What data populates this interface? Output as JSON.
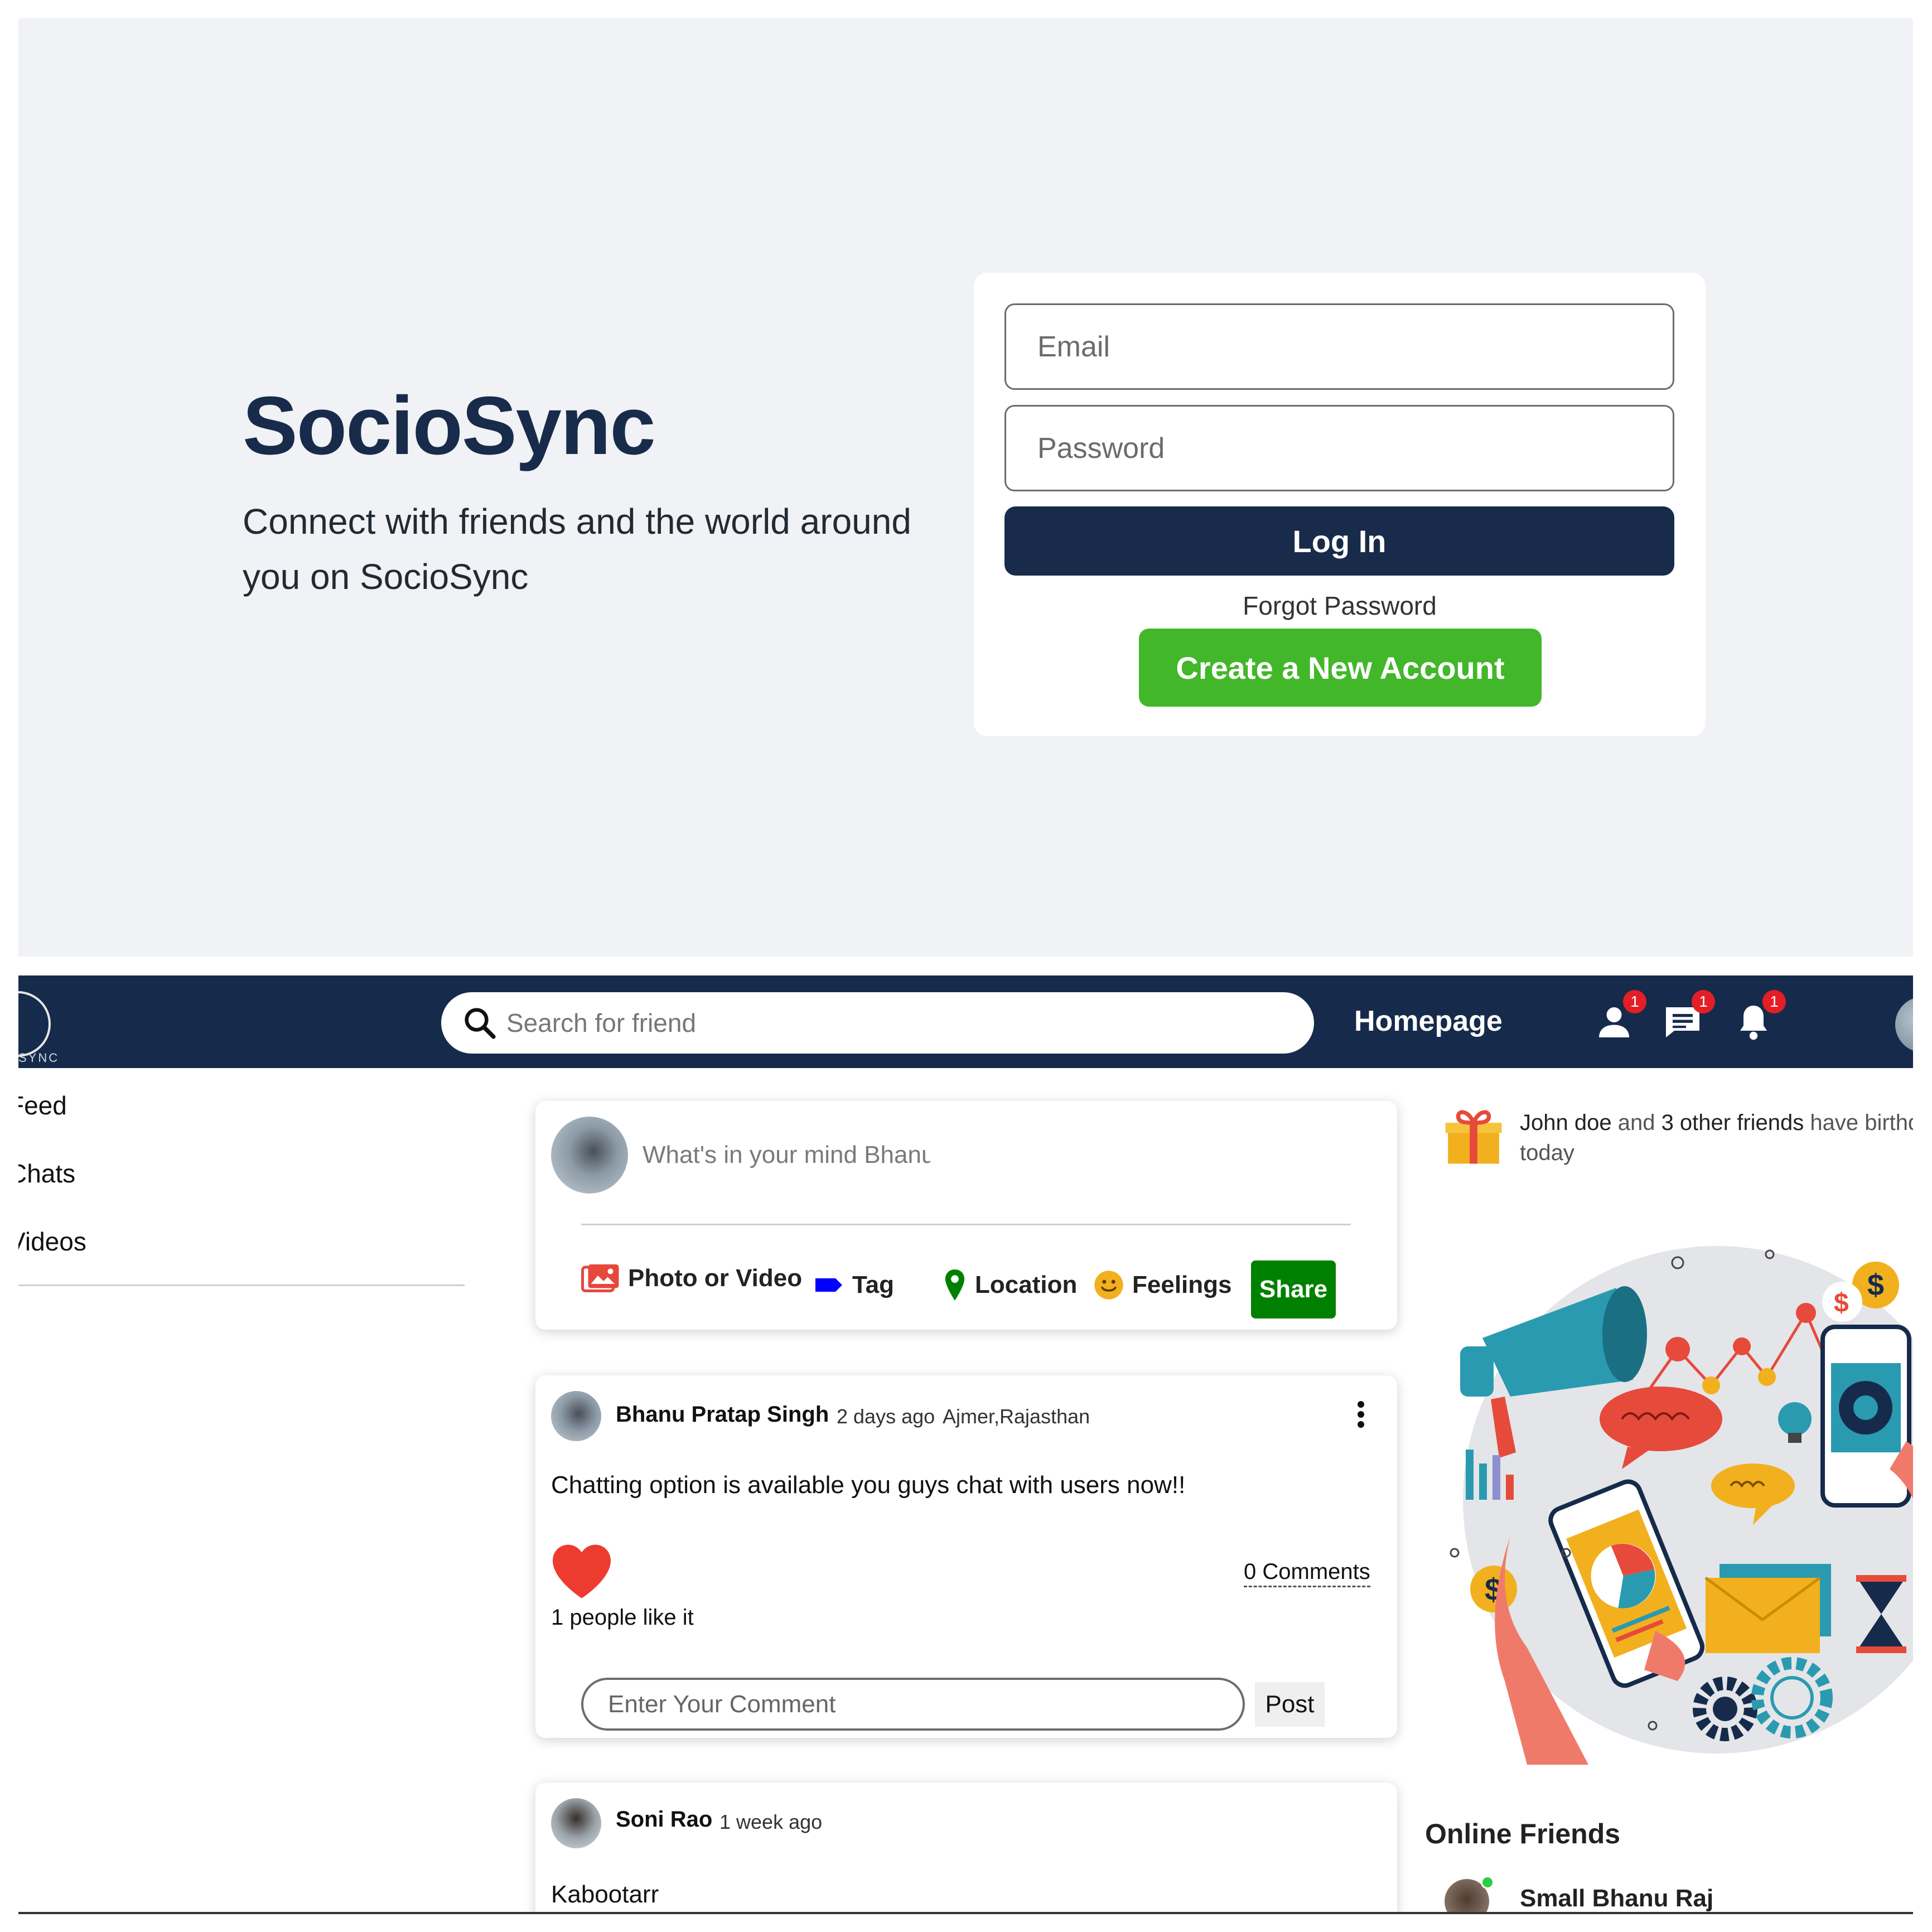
{
  "login": {
    "brand_title": "SocioSync",
    "brand_description": "Connect with friends and the world around you on SocioSync",
    "email_placeholder": "Email",
    "password_placeholder": "Password",
    "login_button": "Log In",
    "forgot_password": "Forgot Password",
    "create_account_button": "Create a New Account"
  },
  "topbar": {
    "logo_text": "SYNC",
    "search_placeholder": "Search for friend",
    "homepage_link": "Homepage",
    "friend_requests_badge": "1",
    "messages_badge": "1",
    "notifications_badge": "1"
  },
  "sidebar": {
    "items": [
      {
        "label": "Feed"
      },
      {
        "label": "Chats"
      },
      {
        "label": "Videos"
      }
    ]
  },
  "share": {
    "placeholder": "What's in your mind Bhanu",
    "options": [
      {
        "label": "Photo or Video",
        "icon": "photo-icon",
        "color": "#e7473c"
      },
      {
        "label": "Tag",
        "icon": "tag-icon",
        "color": "#0000ff"
      },
      {
        "label": "Location",
        "icon": "location-icon",
        "color": "#008000"
      },
      {
        "label": "Feelings",
        "icon": "smile-icon",
        "color": "#f2b01e"
      }
    ],
    "share_button": "Share"
  },
  "posts": [
    {
      "author": "Bhanu Pratap Singh",
      "time": "2 days ago",
      "location": "Ajmer,Rajasthan",
      "text": "Chatting option is available you guys chat with users now!!",
      "likes_text": "1 people like it",
      "comments_text": "0 Comments",
      "comment_placeholder": "Enter Your Comment",
      "post_button": "Post"
    },
    {
      "author": "Soni Rao",
      "time": "1 week ago",
      "text": "Kabootarr"
    }
  ],
  "rightbar": {
    "birthday_name": "John doe",
    "birthday_and": " and ",
    "birthday_others": "3 other friends",
    "birthday_rest": " have birthd",
    "birthday_today": "today",
    "online_title": "Online Friends",
    "online_friends": [
      {
        "name": "Small Bhanu Raj"
      }
    ]
  },
  "colors": {
    "brand_navy": "#192b4a",
    "create_green": "#42b72a",
    "share_green": "#008000",
    "badge_red": "#e41e25",
    "heart_red": "#ee3b2f"
  }
}
